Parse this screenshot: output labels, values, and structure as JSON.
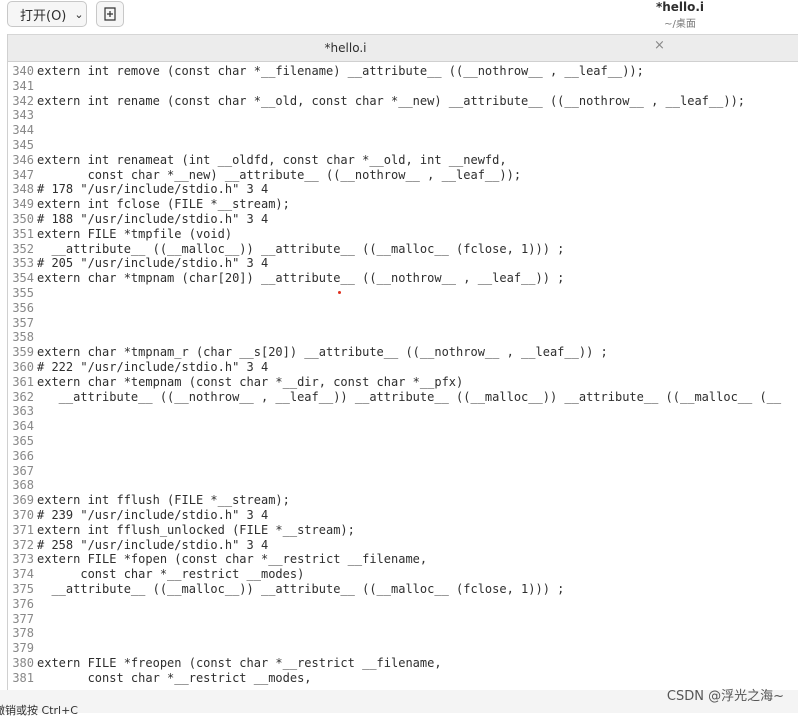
{
  "header": {
    "open_label": "打开(O)",
    "window_title": "*hello.i",
    "window_subtitle": "~/桌面"
  },
  "tab": {
    "label": "*hello.i",
    "close": "×"
  },
  "lines": [
    {
      "n": "340",
      "t": "extern int remove (const char *__filename) __attribute__ ((__nothrow__ , __leaf__));"
    },
    {
      "n": "341",
      "t": ""
    },
    {
      "n": "342",
      "t": "extern int rename (const char *__old, const char *__new) __attribute__ ((__nothrow__ , __leaf__));"
    },
    {
      "n": "343",
      "t": ""
    },
    {
      "n": "344",
      "t": ""
    },
    {
      "n": "345",
      "t": ""
    },
    {
      "n": "346",
      "t": "extern int renameat (int __oldfd, const char *__old, int __newfd,"
    },
    {
      "n": "347",
      "t": "       const char *__new) __attribute__ ((__nothrow__ , __leaf__));"
    },
    {
      "n": "348",
      "t": "# 178 \"/usr/include/stdio.h\" 3 4"
    },
    {
      "n": "349",
      "t": "extern int fclose (FILE *__stream);"
    },
    {
      "n": "350",
      "t": "# 188 \"/usr/include/stdio.h\" 3 4"
    },
    {
      "n": "351",
      "t": "extern FILE *tmpfile (void)"
    },
    {
      "n": "352",
      "t": "  __attribute__ ((__malloc__)) __attribute__ ((__malloc__ (fclose, 1))) ;"
    },
    {
      "n": "353",
      "t": "# 205 \"/usr/include/stdio.h\" 3 4"
    },
    {
      "n": "354",
      "t": "extern char *tmpnam (char[20]) __attribute__ ((__nothrow__ , __leaf__)) ;"
    },
    {
      "n": "355",
      "t": ""
    },
    {
      "n": "356",
      "t": ""
    },
    {
      "n": "357",
      "t": ""
    },
    {
      "n": "358",
      "t": ""
    },
    {
      "n": "359",
      "t": "extern char *tmpnam_r (char __s[20]) __attribute__ ((__nothrow__ , __leaf__)) ;"
    },
    {
      "n": "360",
      "t": "# 222 \"/usr/include/stdio.h\" 3 4"
    },
    {
      "n": "361",
      "t": "extern char *tempnam (const char *__dir, const char *__pfx)"
    },
    {
      "n": "362",
      "t": "   __attribute__ ((__nothrow__ , __leaf__)) __attribute__ ((__malloc__)) __attribute__ ((__malloc__ (__"
    },
    {
      "n": "363",
      "t": ""
    },
    {
      "n": "364",
      "t": ""
    },
    {
      "n": "365",
      "t": ""
    },
    {
      "n": "366",
      "t": ""
    },
    {
      "n": "367",
      "t": ""
    },
    {
      "n": "368",
      "t": ""
    },
    {
      "n": "369",
      "t": "extern int fflush (FILE *__stream);"
    },
    {
      "n": "370",
      "t": "# 239 \"/usr/include/stdio.h\" 3 4"
    },
    {
      "n": "371",
      "t": "extern int fflush_unlocked (FILE *__stream);"
    },
    {
      "n": "372",
      "t": "# 258 \"/usr/include/stdio.h\" 3 4"
    },
    {
      "n": "373",
      "t": "extern FILE *fopen (const char *__restrict __filename,"
    },
    {
      "n": "374",
      "t": "      const char *__restrict __modes)"
    },
    {
      "n": "375",
      "t": "  __attribute__ ((__malloc__)) __attribute__ ((__malloc__ (fclose, 1))) ;"
    },
    {
      "n": "376",
      "t": ""
    },
    {
      "n": "377",
      "t": ""
    },
    {
      "n": "378",
      "t": ""
    },
    {
      "n": "379",
      "t": ""
    },
    {
      "n": "380",
      "t": "extern FILE *freopen (const char *__restrict __filename,"
    },
    {
      "n": "381",
      "t": "       const char *__restrict __modes,"
    }
  ],
  "status": {
    "text": "撤销或按 Ctrl+C"
  },
  "watermark": "CSDN @浮光之海~"
}
